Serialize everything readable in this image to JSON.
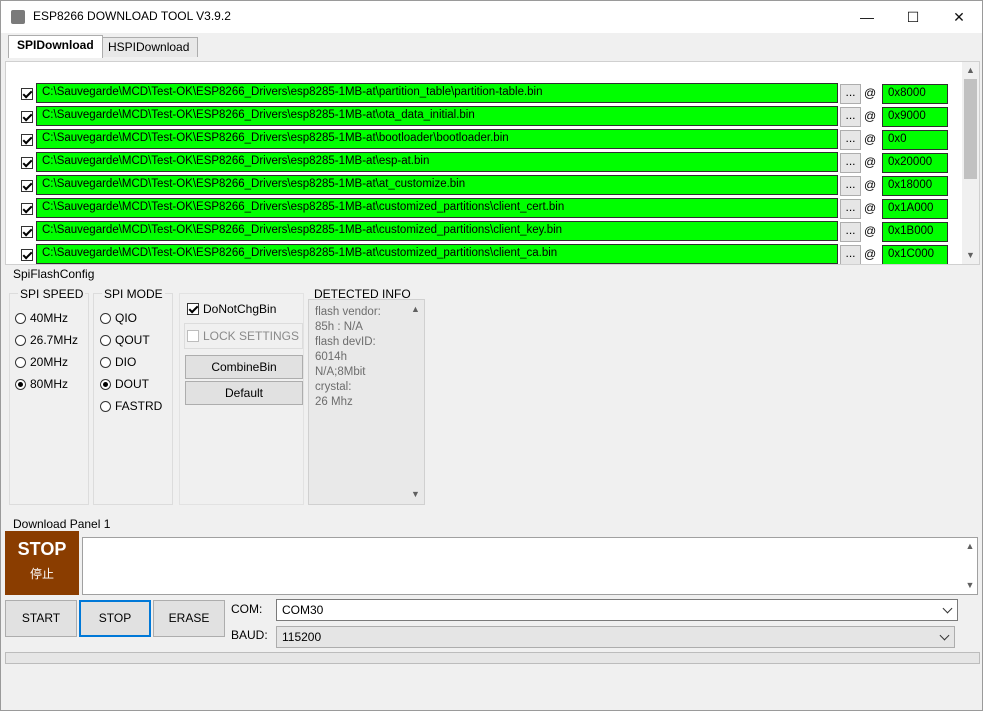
{
  "window": {
    "title": "ESP8266 DOWNLOAD TOOL V3.9.2",
    "minimize": "—",
    "maximize": "☐",
    "close": "✕"
  },
  "tabs": [
    {
      "label": "SPIDownload",
      "active": true
    },
    {
      "label": "HSPIDownload",
      "active": false
    }
  ],
  "files": [
    {
      "checked": true,
      "path": "C:\\Sauvegarde\\MCD\\Test-OK\\ESP8266_Drivers\\esp8285-1MB-at\\partition_table\\partition-table.bin",
      "browse": "...",
      "at": "@",
      "address": "0x8000"
    },
    {
      "checked": true,
      "path": "C:\\Sauvegarde\\MCD\\Test-OK\\ESP8266_Drivers\\esp8285-1MB-at\\ota_data_initial.bin",
      "browse": "...",
      "at": "@",
      "address": "0x9000"
    },
    {
      "checked": true,
      "path": "C:\\Sauvegarde\\MCD\\Test-OK\\ESP8266_Drivers\\esp8285-1MB-at\\bootloader\\bootloader.bin",
      "browse": "...",
      "at": "@",
      "address": "0x0"
    },
    {
      "checked": true,
      "path": "C:\\Sauvegarde\\MCD\\Test-OK\\ESP8266_Drivers\\esp8285-1MB-at\\esp-at.bin",
      "browse": "...",
      "at": "@",
      "address": "0x20000"
    },
    {
      "checked": true,
      "path": "C:\\Sauvegarde\\MCD\\Test-OK\\ESP8266_Drivers\\esp8285-1MB-at\\at_customize.bin",
      "browse": "...",
      "at": "@",
      "address": "0x18000"
    },
    {
      "checked": true,
      "path": "C:\\Sauvegarde\\MCD\\Test-OK\\ESP8266_Drivers\\esp8285-1MB-at\\customized_partitions\\client_cert.bin",
      "browse": "...",
      "at": "@",
      "address": "0x1A000"
    },
    {
      "checked": true,
      "path": "C:\\Sauvegarde\\MCD\\Test-OK\\ESP8266_Drivers\\esp8285-1MB-at\\customized_partitions\\client_key.bin",
      "browse": "...",
      "at": "@",
      "address": "0x1B000"
    },
    {
      "checked": true,
      "path": "C:\\Sauvegarde\\MCD\\Test-OK\\ESP8266_Drivers\\esp8285-1MB-at\\customized_partitions\\client_ca.bin",
      "browse": "...",
      "at": "@",
      "address": "0x1C000"
    }
  ],
  "spiflash": {
    "label": "SpiFlashConfig",
    "speed": {
      "title": "SPI SPEED",
      "options": [
        {
          "label": "40MHz",
          "selected": false
        },
        {
          "label": "26.7MHz",
          "selected": false
        },
        {
          "label": "20MHz",
          "selected": false
        },
        {
          "label": "80MHz",
          "selected": true
        }
      ]
    },
    "mode": {
      "title": "SPI MODE",
      "options": [
        {
          "label": "QIO",
          "selected": false
        },
        {
          "label": "QOUT",
          "selected": false
        },
        {
          "label": "DIO",
          "selected": false
        },
        {
          "label": "DOUT",
          "selected": true
        },
        {
          "label": "FASTRD",
          "selected": false
        }
      ]
    },
    "donotchgbin": {
      "label": "DoNotChgBin",
      "checked": true
    },
    "lock_settings": {
      "label": "LOCK SETTINGS",
      "checked": false
    },
    "combine_bin": "CombineBin",
    "default": "Default",
    "detected": {
      "title": "DETECTED INFO",
      "lines": [
        "flash vendor:",
        "85h : N/A",
        "flash devID:",
        "6014h",
        "N/A;8Mbit",
        "crystal:",
        "26 Mhz"
      ]
    }
  },
  "download": {
    "panel_label": "Download Panel 1",
    "status": {
      "main": "STOP",
      "sub": "停止",
      "color": "#8a3d00"
    },
    "log": ""
  },
  "actions": {
    "start": "START",
    "stop": "STOP",
    "erase": "ERASE"
  },
  "com": {
    "label": "COM:",
    "value": "COM30"
  },
  "baud": {
    "label": "BAUD:",
    "value": "115200"
  }
}
